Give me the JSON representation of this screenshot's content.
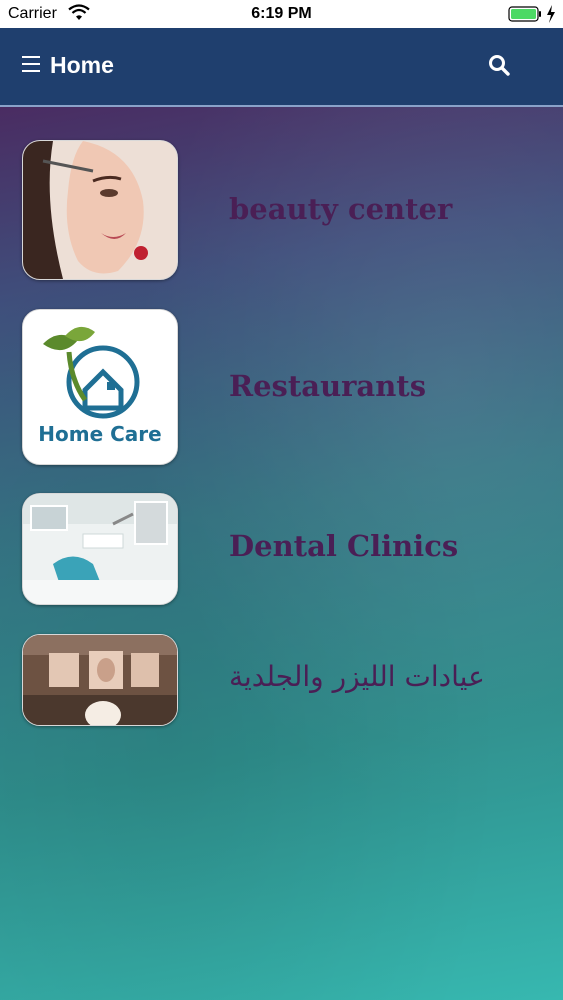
{
  "status_bar": {
    "carrier": "Carrier",
    "time": "6:19 PM"
  },
  "nav": {
    "title": "Home",
    "menu_icon": "hamburger-menu-icon",
    "search_icon": "search-icon",
    "background_color": "#1f3f6e"
  },
  "categories": [
    {
      "label": "beauty center",
      "thumb": "beauty-face-image"
    },
    {
      "label": "Restaurants",
      "thumb": "home-care-logo",
      "logo_text": "Home Care"
    },
    {
      "label": "Dental Clinics",
      "thumb": "dental-clinic-image"
    },
    {
      "label": "عيادات الليزر والجلدية",
      "thumb": "laser-clinic-image"
    }
  ],
  "colors": {
    "label_color": "#4a1f55",
    "accent_green": "#5b8a2c",
    "accent_blue": "#1f6f94"
  }
}
